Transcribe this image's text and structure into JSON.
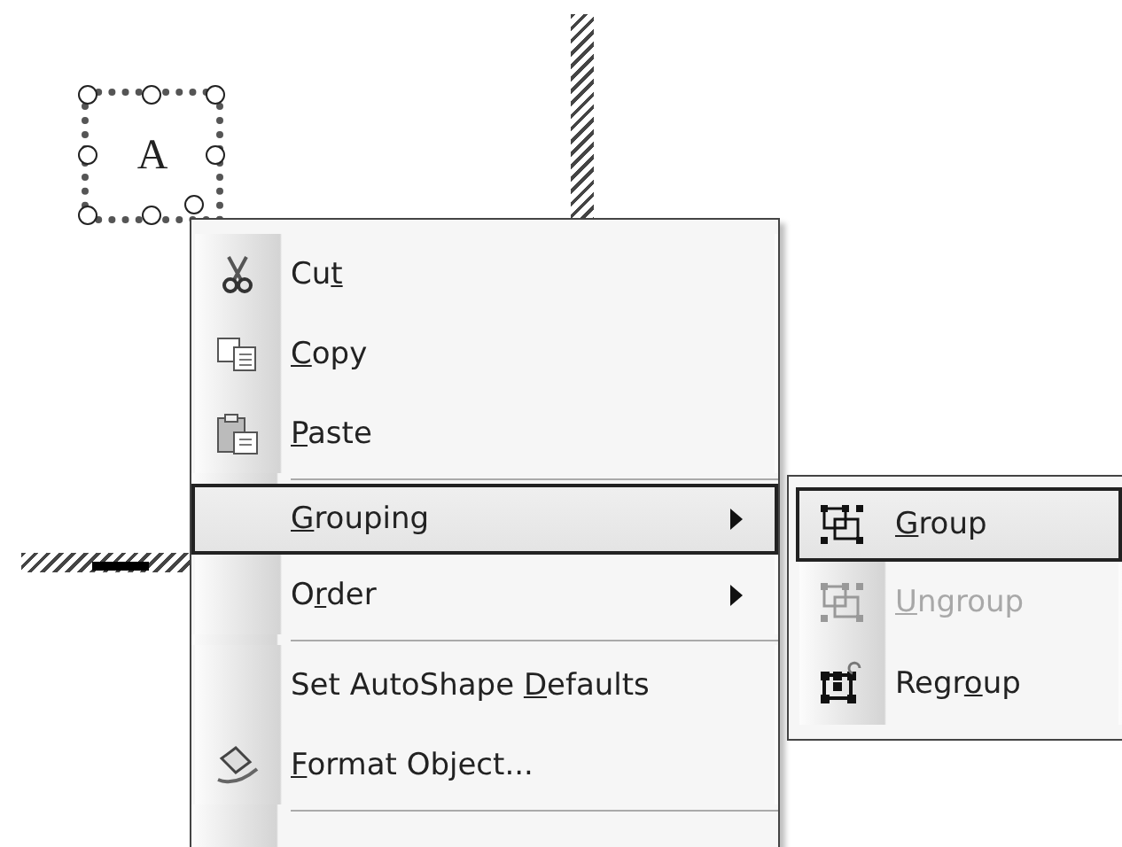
{
  "shape": {
    "text": "A"
  },
  "context_menu": {
    "items": [
      {
        "kind": "item",
        "label": {
          "before": "Cu",
          "key": "t"
        },
        "submenu": false,
        "selected": false,
        "disabled": false
      },
      {
        "kind": "item",
        "label": {
          "key": "C",
          "after": "opy"
        },
        "submenu": false,
        "selected": false,
        "disabled": false
      },
      {
        "kind": "item",
        "label": {
          "key": "P",
          "after": "aste"
        },
        "submenu": false,
        "selected": false,
        "disabled": false
      },
      {
        "kind": "separator"
      },
      {
        "kind": "item",
        "label": {
          "key": "G",
          "after": "rouping"
        },
        "submenu": true,
        "selected": true,
        "disabled": false
      },
      {
        "kind": "item",
        "label": {
          "before": "O",
          "key": "r",
          "after": "der"
        },
        "submenu": true,
        "selected": false,
        "disabled": false
      },
      {
        "kind": "separator"
      },
      {
        "kind": "item",
        "label": {
          "before": "Set AutoShape ",
          "key": "D",
          "after": "efaults"
        },
        "submenu": false,
        "selected": false,
        "disabled": false
      },
      {
        "kind": "item",
        "label": {
          "key": "F",
          "after": "ormat Object..."
        },
        "submenu": false,
        "selected": false,
        "disabled": false
      },
      {
        "kind": "separator"
      }
    ]
  },
  "submenu": {
    "items": [
      {
        "label": {
          "key": "G",
          "after": "roup"
        },
        "selected": true,
        "disabled": false
      },
      {
        "label": {
          "key": "U",
          "after": "ngroup"
        },
        "selected": false,
        "disabled": true
      },
      {
        "label": {
          "before": "Regr",
          "key": "o",
          "after": "up"
        },
        "selected": false,
        "disabled": false
      }
    ]
  }
}
